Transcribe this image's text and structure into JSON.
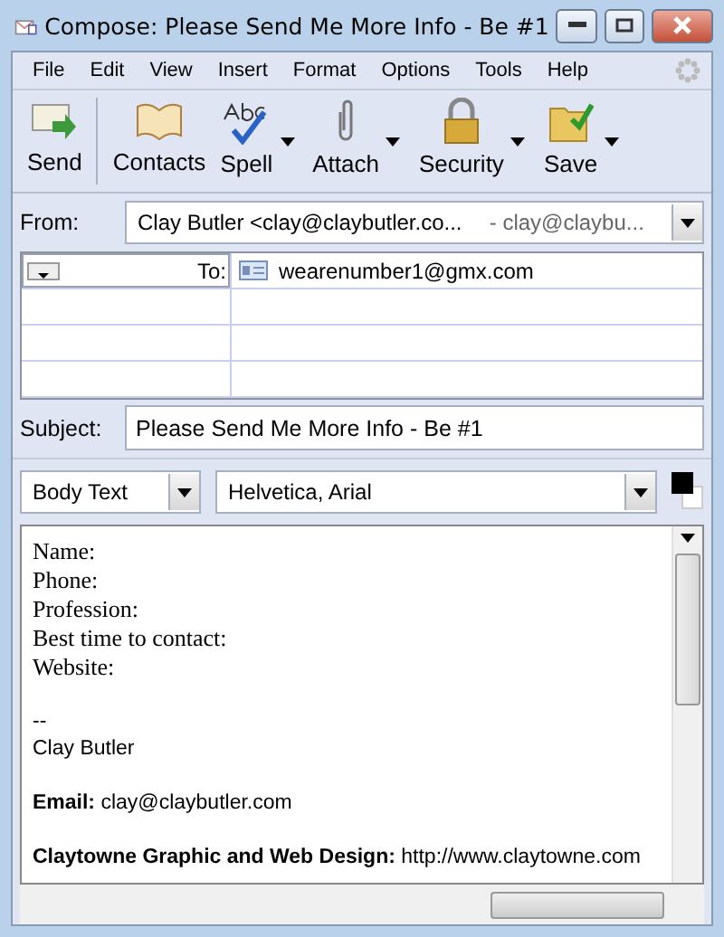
{
  "window": {
    "title": "Compose: Please Send Me More Info - Be #1"
  },
  "menu": [
    "File",
    "Edit",
    "View",
    "Insert",
    "Format",
    "Options",
    "Tools",
    "Help"
  ],
  "toolbar": [
    {
      "label": "Send",
      "kind": "send",
      "dropdown": false
    },
    {
      "label": "Contacts",
      "kind": "contacts",
      "dropdown": false
    },
    {
      "label": "Spell",
      "kind": "spell",
      "dropdown": true
    },
    {
      "label": "Attach",
      "kind": "attach",
      "dropdown": true
    },
    {
      "label": "Security",
      "kind": "security",
      "dropdown": true
    },
    {
      "label": "Save",
      "kind": "save",
      "dropdown": true
    }
  ],
  "from": {
    "label": "From:",
    "name": "Clay Butler <clay@claybutler.co...",
    "account": "- clay@claybu..."
  },
  "recipients": [
    {
      "type": "To:",
      "address": "wearenumber1@gmx.com"
    }
  ],
  "subject": {
    "label": "Subject:",
    "value": "Please Send Me More Info - Be #1"
  },
  "format": {
    "style": "Body Text",
    "font": "Helvetica, Arial"
  },
  "body": [
    {
      "kind": "serif",
      "text": "Name:"
    },
    {
      "kind": "serif",
      "text": "Phone:"
    },
    {
      "kind": "serif",
      "text": "Profession:"
    },
    {
      "kind": "serif",
      "text": "Best time to contact:"
    },
    {
      "kind": "serif",
      "text": "Website:"
    },
    {
      "kind": "gap"
    },
    {
      "kind": "sans",
      "text": "--"
    },
    {
      "kind": "sans",
      "text": "Clay Butler"
    },
    {
      "kind": "gap"
    },
    {
      "kind": "sans",
      "text": "**Email:** clay@claybutler.com"
    },
    {
      "kind": "gap"
    },
    {
      "kind": "sans",
      "text": "**Claytowne Graphic and Web Design:** http://www.claytowne.com"
    }
  ]
}
